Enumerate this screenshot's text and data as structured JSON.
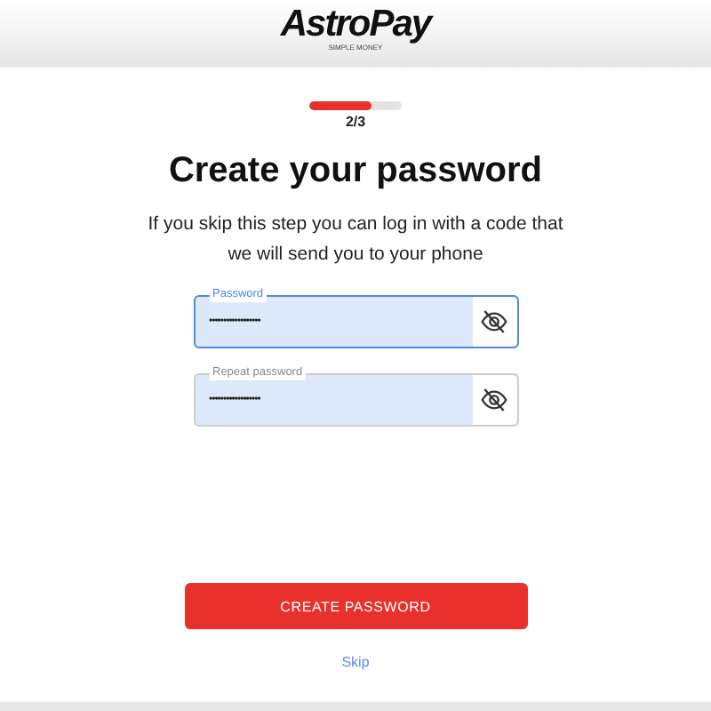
{
  "header": {
    "logo": "AstroPay",
    "tagline": "SIMPLE MONEY"
  },
  "progress": {
    "level": 0.68,
    "label": "2/3"
  },
  "title": "Create your password",
  "subtitle": "If you skip this step you can log in with a code that we will send you to your phone",
  "fields": [
    {
      "label": "Password",
      "value": "••••••••••••••••••",
      "focused": true
    },
    {
      "label": "Repeat password",
      "value": "••••••••••••••••••",
      "focused": false
    }
  ],
  "primary_button": "CREATE PASSWORD",
  "skip_link": "Skip"
}
